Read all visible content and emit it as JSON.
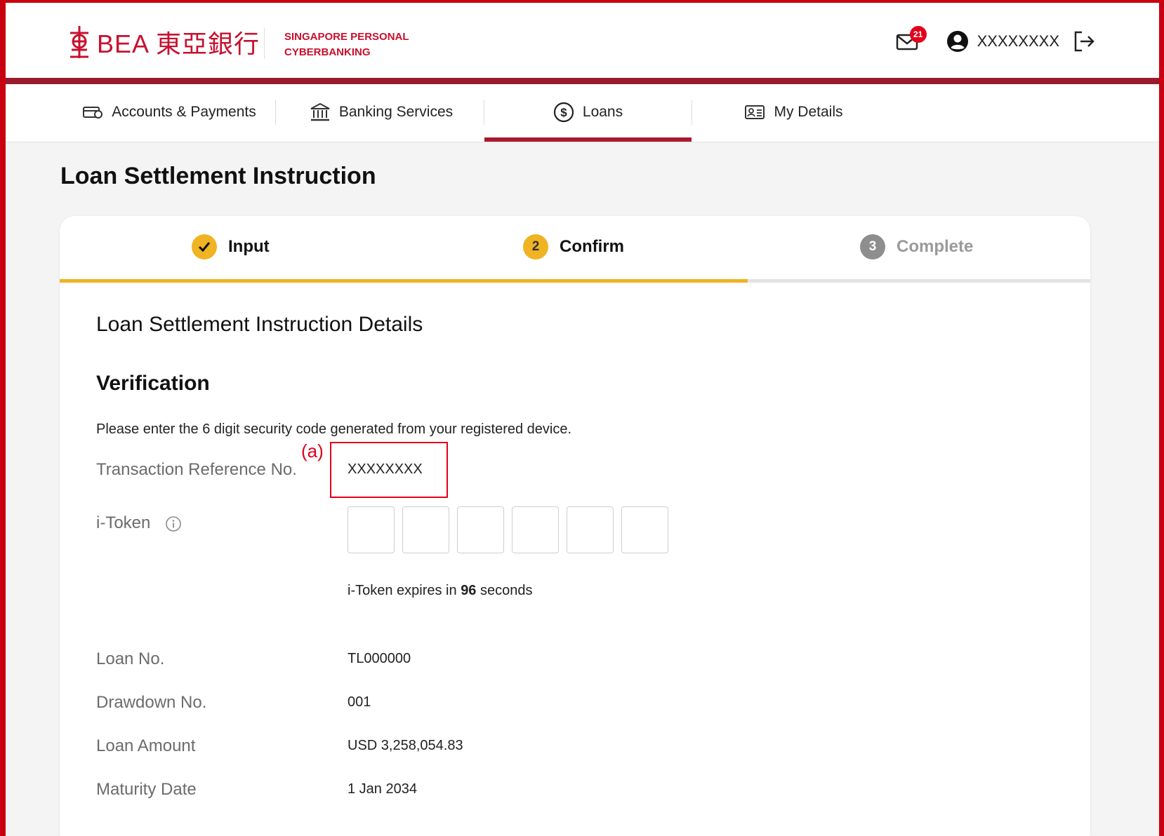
{
  "header": {
    "brand": "BEA 東亞銀行",
    "sub_line1": "SINGAPORE PERSONAL",
    "sub_line2": "CYBERBANKING",
    "mail_count": "21",
    "username": "XXXXXXXX"
  },
  "nav": {
    "items": [
      {
        "label": "Accounts & Payments",
        "icon": "wallet-icon"
      },
      {
        "label": "Banking Services",
        "icon": "bank-icon"
      },
      {
        "label": "Loans",
        "icon": "dollar-circle-icon",
        "active": true
      },
      {
        "label": "My Details",
        "icon": "id-card-icon"
      }
    ]
  },
  "page": {
    "title": "Loan Settlement Instruction"
  },
  "steps": [
    {
      "number": "",
      "label": "Input",
      "state": "done"
    },
    {
      "number": "2",
      "label": "Confirm",
      "state": "current"
    },
    {
      "number": "3",
      "label": "Complete",
      "state": "todo"
    }
  ],
  "details": {
    "section_title": "Loan Settlement Instruction Details",
    "verification_title": "Verification",
    "instruction": "Please enter the 6 digit security code generated from your registered device.",
    "annotation": "(a)",
    "ref_label": "Transaction Reference No.",
    "ref_value": "XXXXXXXX",
    "itoken_label": "i-Token",
    "itoken_expiry_prefix": "i-Token expires in ",
    "itoken_expiry_seconds": "96",
    "itoken_expiry_suffix": " seconds",
    "loan_no_label": "Loan No.",
    "loan_no_value": "TL000000",
    "drawdown_label": "Drawdown No.",
    "drawdown_value": "001",
    "amount_label": "Loan Amount",
    "amount_value": "USD 3,258,054.83",
    "maturity_label": "Maturity Date",
    "maturity_value": "1 Jan 2034"
  },
  "colors": {
    "brand_red": "#c8102e",
    "accent_yellow": "#f0b323",
    "nav_active": "#a8192e"
  }
}
